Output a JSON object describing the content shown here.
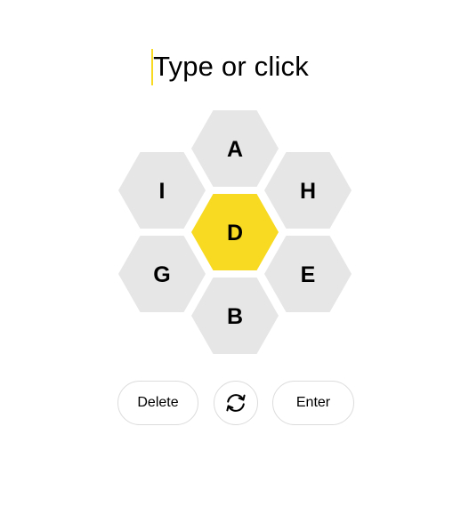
{
  "input": {
    "placeholder": "Type or click"
  },
  "hive": {
    "center_letter": "D",
    "outer_letters": [
      "A",
      "H",
      "E",
      "B",
      "G",
      "I"
    ]
  },
  "controls": {
    "delete_label": "Delete",
    "shuffle_icon": "shuffle-icon",
    "enter_label": "Enter"
  },
  "colors": {
    "center_cell": "#f7da21",
    "outer_cell": "#e6e6e6",
    "caret": "#f7da21",
    "button_border": "#dcdcdc"
  }
}
